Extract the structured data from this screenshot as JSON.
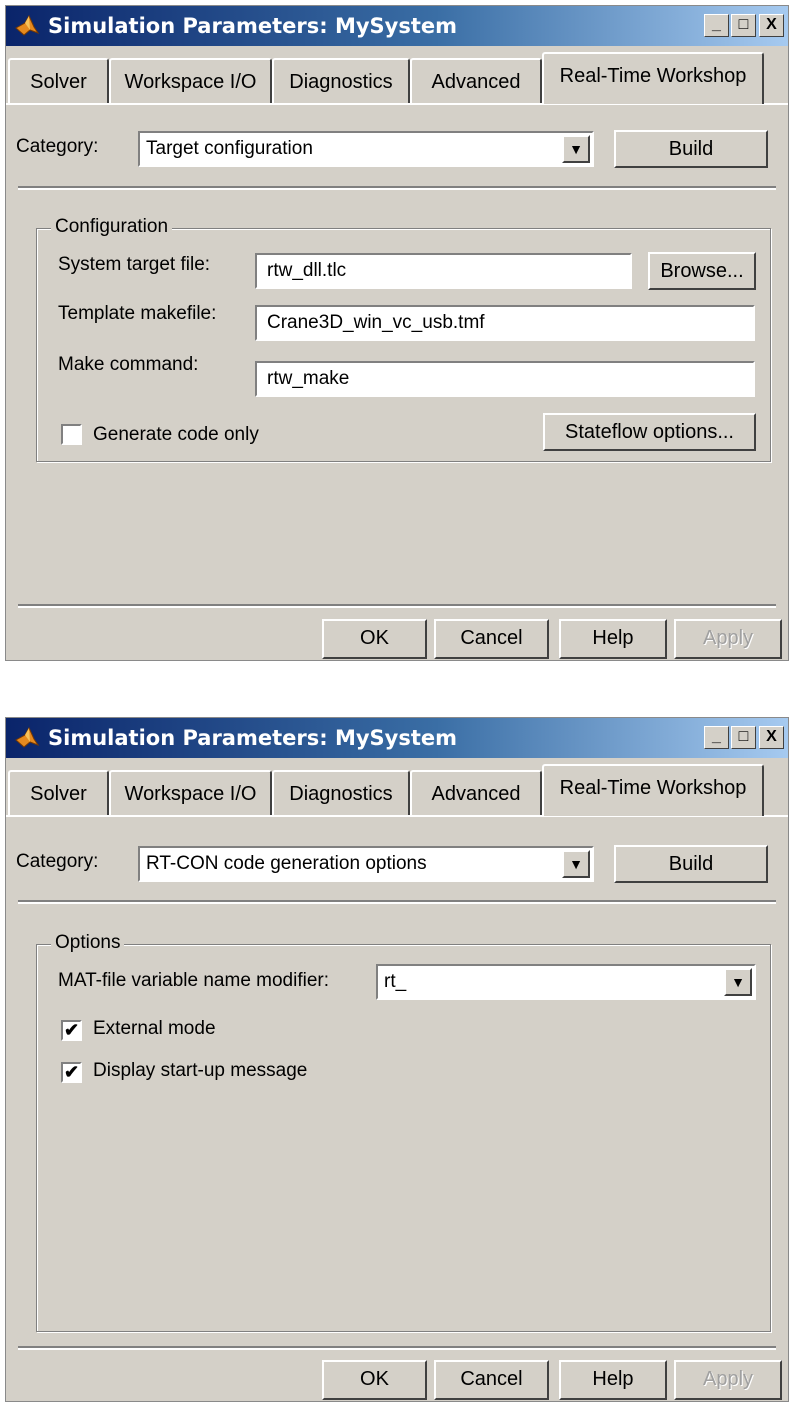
{
  "dialogs": [
    {
      "title": "Simulation Parameters: MySystem",
      "window_buttons": {
        "minimize": "_",
        "maximize": "□",
        "close": "X"
      },
      "tabs": [
        "Solver",
        "Workspace I/O",
        "Diagnostics",
        "Advanced",
        "Real-Time Workshop"
      ],
      "active_tab": "Real-Time Workshop",
      "category_label": "Category:",
      "category_value": "Target configuration",
      "build_label": "Build",
      "group_title": "Configuration",
      "system_target_label": "System target file:",
      "system_target_value": "rtw_dll.tlc",
      "browse_label": "Browse...",
      "template_label": "Template makefile:",
      "template_value": "Crane3D_win_vc_usb.tmf",
      "make_label": "Make command:",
      "make_value": "rtw_make",
      "generate_label": "Generate code only",
      "generate_checked": false,
      "stateflow_label": "Stateflow options...",
      "ok_label": "OK",
      "cancel_label": "Cancel",
      "help_label": "Help",
      "apply_label": "Apply"
    },
    {
      "title": "Simulation Parameters: MySystem",
      "window_buttons": {
        "minimize": "_",
        "maximize": "□",
        "close": "X"
      },
      "tabs": [
        "Solver",
        "Workspace I/O",
        "Diagnostics",
        "Advanced",
        "Real-Time Workshop"
      ],
      "active_tab": "Real-Time Workshop",
      "category_label": "Category:",
      "category_value": "RT-CON code generation options",
      "build_label": "Build",
      "group_title": "Options",
      "mat_label": "MAT-file variable name modifier:",
      "mat_value": "rt_",
      "external_label": "External mode",
      "external_checked": true,
      "display_label": "Display start-up message",
      "display_checked": true,
      "ok_label": "OK",
      "cancel_label": "Cancel",
      "help_label": "Help",
      "apply_label": "Apply"
    }
  ],
  "colors": {
    "face": "#d4d0c8",
    "title_start": "#0a246a",
    "title_end": "#a6caf0"
  },
  "icons": {
    "app": "matlab-logo-icon",
    "dropdown": "chevron-down-icon",
    "check": "checkmark-icon"
  }
}
